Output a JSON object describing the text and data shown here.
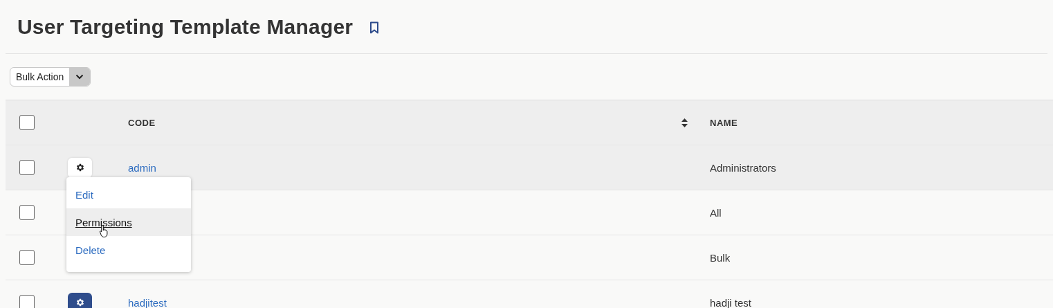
{
  "page": {
    "title": "User Targeting Template Manager",
    "bookmarked": false
  },
  "bulk_action": {
    "label": "Bulk Action"
  },
  "table": {
    "select_all_checked": false,
    "columns": [
      {
        "label": "CODE",
        "sortable": true
      },
      {
        "label": "NAME",
        "sortable": false
      }
    ],
    "rows": [
      {
        "checked": false,
        "actions": {
          "menu_open": true
        },
        "code": "admin",
        "name": "Administrators"
      },
      {
        "checked": false,
        "name": "All"
      },
      {
        "checked": false,
        "name": "Bulk"
      },
      {
        "checked": false,
        "actions": {
          "menu_open": false
        },
        "code": "hadjitest",
        "name": "hadji test"
      }
    ]
  },
  "action_menu": {
    "items": [
      {
        "label": "Edit",
        "selected": false
      },
      {
        "label": "Permissions",
        "selected": true
      },
      {
        "label": "Delete",
        "selected": false
      }
    ]
  }
}
